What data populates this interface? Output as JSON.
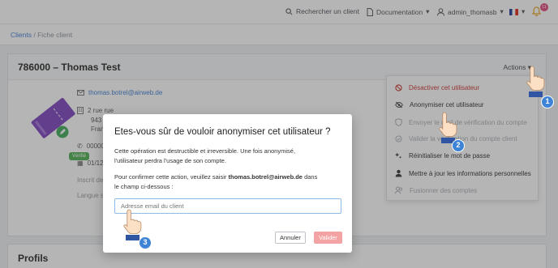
{
  "topbar": {
    "search_label": "Rechercher un client",
    "doc_label": "Documentation",
    "user_label": "admin_thomasb",
    "notif_count": "11",
    "flag_colors": [
      "#1f3a93",
      "#ffffff",
      "#e1241b"
    ]
  },
  "breadcrumb": {
    "root": "Clients",
    "current": "Fiche client"
  },
  "client": {
    "title": "786000 – Thomas Test",
    "actions_label": "Actions",
    "email": "thomas.botrel@airweb.de",
    "address_line1": "2 rue rue",
    "address_line2": "943",
    "address_line3": "Fran",
    "phone": "00000",
    "date": "01/12/",
    "inscrit_label": "Inscrit de",
    "langue_label": "Langue s",
    "verified_badge": "Vérifié"
  },
  "profiles_title": "Profils",
  "menu": {
    "items": [
      {
        "label": "Désactiver cet utilisateur",
        "icon": "ban-icon"
      },
      {
        "label": "Anonymiser cet utilisateur",
        "icon": "eye-slash-icon"
      },
      {
        "label": "Envoyer le mail de vérification du compte",
        "icon": "shield-icon"
      },
      {
        "label": "Valider la vérification du compte client",
        "icon": "check-circle-icon"
      },
      {
        "label": "Réinitialiser le mot de passe",
        "icon": "sparkle-icon"
      },
      {
        "label": "Mettre à jour les informations personnelles",
        "icon": "user-icon"
      },
      {
        "label": "Fusionner des comptes",
        "icon": "users-icon"
      }
    ]
  },
  "modal": {
    "title": "Etes-vous sûr de vouloir anonymiser cet utilisateur ?",
    "line1": "Cette opération est destructible et irreversible. Une fois anonymisé,",
    "line2": "l'utilisateur perdra l'usage de son compte.",
    "confirm_prefix": "Pour confirmer cette action, veuillez saisir ",
    "confirm_email": "thomas.botrel@airweb.de",
    "confirm_suffix": " dans",
    "confirm_line2": "le champ ci-dessous :",
    "input_placeholder": "Adresse email du client",
    "cancel_label": "Annuler",
    "validate_label": "Valider"
  },
  "callouts": [
    "1",
    "2",
    "3"
  ]
}
